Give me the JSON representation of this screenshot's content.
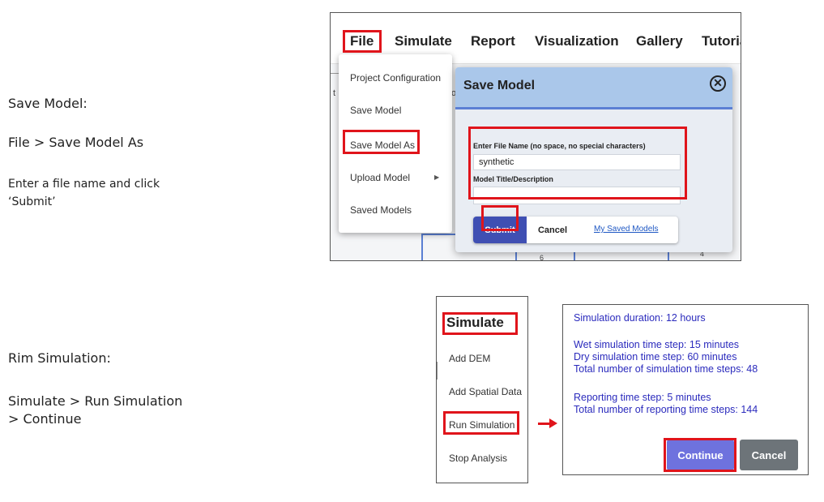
{
  "save_section": {
    "heading": "Save Model:",
    "path": "File > Save Model As",
    "instruction_line1": "Enter a file name and click",
    "instruction_line2": "‘Submit’"
  },
  "run_section": {
    "heading": "Rim Simulation:",
    "path_line1": "Simulate > Run Simulation",
    "path_line2": "> Continue"
  },
  "shot1": {
    "menubar": [
      "File",
      "Simulate",
      "Report",
      "Visualization",
      "Gallery",
      "Tutoria"
    ],
    "file_menu": [
      "Project Configuration",
      "Save Model",
      "Save Model As",
      "Upload Model",
      "Saved Models"
    ],
    "submenu_icon": "caret-right-icon",
    "background_fragments": [
      "t",
      "o",
      "6",
      "4"
    ],
    "dialog": {
      "title": "Save Model",
      "close_icon": "close-circle-icon",
      "file_name_label": "Enter File Name (no space, no special characters)",
      "file_name_value": "synthetic",
      "title_label": "Model Title/Description",
      "title_value": "",
      "submit_label": "Submit",
      "cancel_label": "Cancel",
      "saved_models_link": "My Saved Models"
    }
  },
  "shot2": {
    "title": "Simulate",
    "items": [
      "Add DEM",
      "Add Spatial Data",
      "Run Simulation",
      "Stop Analysis"
    ]
  },
  "shot3": {
    "duration": "Simulation duration: 12 hours",
    "wet_step": "Wet simulation time step: 15 minutes",
    "dry_step": "Dry simulation time step: 60 minutes",
    "total_steps": "Total number of simulation time steps: 48",
    "report_step": "Reporting time step: 5 minutes",
    "total_report_steps": "Total number of reporting time steps: 144",
    "continue_label": "Continue",
    "cancel_label": "Cancel"
  },
  "colors": {
    "highlight": "#e0141b",
    "dialog_header": "#aac7ea",
    "submit_button": "#3f4fb3",
    "info_text": "#2b2bbd",
    "continue_button": "#6e72de",
    "cancel_button": "#6d7479"
  }
}
